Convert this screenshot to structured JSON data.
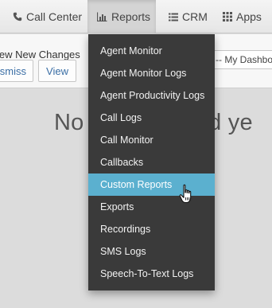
{
  "nav": {
    "items": [
      {
        "label": "Call Center",
        "icon": "phone-icon"
      },
      {
        "label": "Reports",
        "icon": "bar-chart-icon"
      },
      {
        "label": "CRM",
        "icon": "list-icon"
      },
      {
        "label": "Apps",
        "icon": "grid-icon"
      }
    ]
  },
  "toolbar": {
    "changes_text": "iew New Changes",
    "dismiss_label": "ismiss",
    "view_label": "View",
    "dashboard_select": "-- My Dashbo"
  },
  "main": {
    "big_text": "No                 ed ye"
  },
  "reports_menu": {
    "items": [
      "Agent Monitor",
      "Agent Monitor Logs",
      "Agent Productivity Logs",
      "Call Logs",
      "Call Monitor",
      "Callbacks",
      "Custom Reports",
      "Exports",
      "Recordings",
      "SMS Logs",
      "Speech-To-Text Logs"
    ],
    "highlighted": "Custom Reports"
  },
  "colors": {
    "menu_bg": "#3a3a3a",
    "highlight": "#5bb0cf",
    "link": "#3a6ea5"
  }
}
